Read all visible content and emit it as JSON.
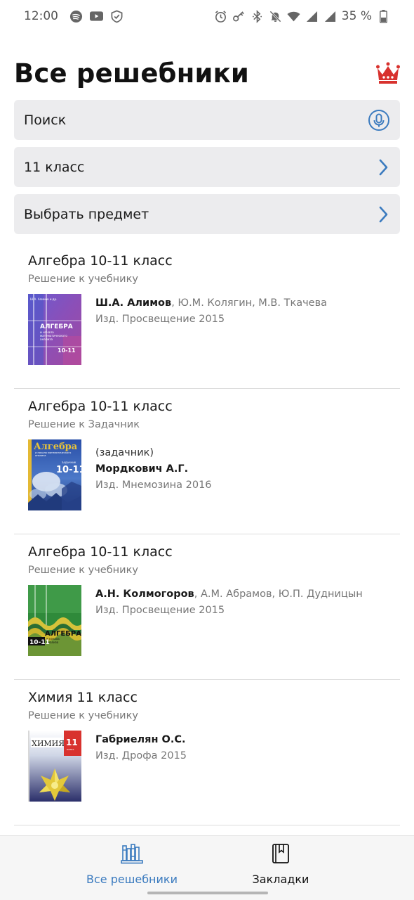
{
  "status_bar": {
    "time": "12:00",
    "battery": "35 %",
    "left_icons": [
      "spotify-icon",
      "youtube-icon",
      "shield-icon"
    ],
    "right_icons": [
      "alarm-icon",
      "key-icon",
      "bluetooth-icon",
      "mute-icon",
      "wifi-icon",
      "signal-icon",
      "signal-icon",
      "battery-icon"
    ]
  },
  "header": {
    "title": "Все решебники",
    "premium_icon": "crown-icon",
    "accent_color": "#d8322e"
  },
  "search": {
    "placeholder": "Поиск",
    "icon": "microphone-icon"
  },
  "filters": {
    "grade": "11 класс",
    "subject": "Выбрать предмет",
    "icon": "chevron-right-icon",
    "icon_color": "#3b7bbf"
  },
  "books": [
    {
      "title": "Алгебра 10-11 класс",
      "subtitle": "Решение к учебнику",
      "main_author": "Ш.А. Алимов",
      "co_authors": ", Ю.М. Колягин, М.В. Ткачева",
      "publisher": "Изд. Просвещение 2015",
      "cover_title": "АЛГЕБРА",
      "cover_subtitle": "и начала математического анализа",
      "cover_grade": "10-11"
    },
    {
      "title": "Алгебра 10-11 класс",
      "subtitle": "Решение к Задачник",
      "note": " (задачник)",
      "main_author": "Мордкович А.Г.",
      "publisher": "Изд. Мнемозина 2016",
      "cover_title": "Алгебра",
      "cover_grade": "10-11"
    },
    {
      "title": "Алгебра 10-11 класс",
      "subtitle": "Решение к учебнику",
      "main_author": "А.Н. Колмогоров",
      "co_authors": ", А.М. Абрамов, Ю.П. Дудницын",
      "publisher": "Изд. Просвещение 2015",
      "cover_title": "АЛГЕБРА",
      "cover_subtitle": "и начала анализа",
      "cover_grade": "10-11"
    },
    {
      "title": "Химия 11 класс",
      "subtitle": "Решение к учебнику",
      "main_author": "Габриелян О.С.",
      "publisher": "Изд. Дрофа 2015",
      "cover_title": "ХИМИЯ",
      "cover_grade": "11"
    }
  ],
  "bottom_nav": {
    "all_label": "Все решебники",
    "all_icon": "books-icon",
    "bookmarks_label": "Закладки",
    "bookmarks_icon": "bookmark-book-icon",
    "active_color": "#3b7bbf"
  }
}
